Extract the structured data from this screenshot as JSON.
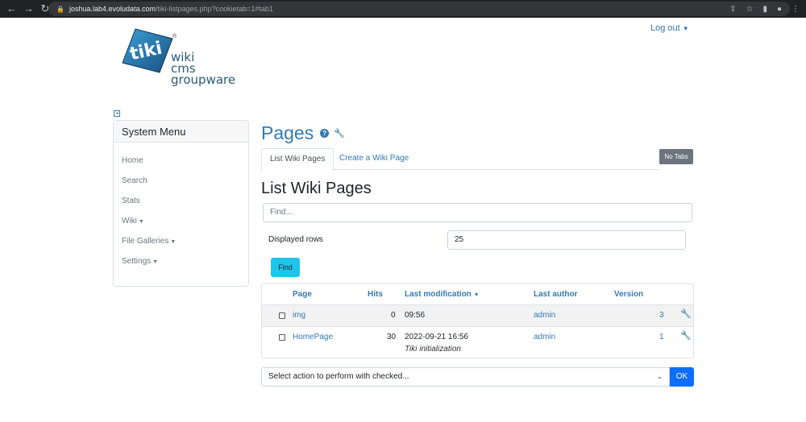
{
  "browser": {
    "url_host": "joshua.lab4.evoludata.com",
    "url_path": "/tiki-listpages.php?cookietab=1#tab1"
  },
  "header": {
    "logout_label": "Log out",
    "logo_text": "tiki",
    "logo_lines": [
      "wiki",
      "cms",
      "groupware"
    ]
  },
  "sidebar": {
    "title": "System Menu",
    "items": [
      {
        "label": "Home"
      },
      {
        "label": "Search"
      },
      {
        "label": "Stats"
      },
      {
        "label": "Wiki"
      },
      {
        "label": "File Galleries"
      },
      {
        "label": "Settings"
      }
    ]
  },
  "main": {
    "page_title": "Pages",
    "tabs": [
      {
        "label": "List Wiki Pages"
      },
      {
        "label": "Create a Wiki Page"
      }
    ],
    "no_tabs_label": "No Tabs",
    "section_title": "List Wiki Pages",
    "find_placeholder": "Find...",
    "displayed_rows_label": "Displayed rows",
    "displayed_rows_value": "25",
    "find_button": "Find",
    "table": {
      "headers": [
        "Page",
        "Hits",
        "Last modification",
        "Last author",
        "Version"
      ],
      "rows": [
        {
          "page": "img",
          "hits": "0",
          "modified": "09:56",
          "note": "",
          "author": "admin",
          "version": "3"
        },
        {
          "page": "HomePage",
          "hits": "30",
          "modified": "2022-09-21 16:56",
          "note": "Tiki initialization",
          "author": "admin",
          "version": "1"
        }
      ]
    },
    "action_select": "Select action to perform with checked...",
    "ok_button": "OK"
  },
  "colors": {
    "link": "#337ab7",
    "find_button": "#1ec5ea",
    "ok_button": "#0d6efd",
    "no_tabs": "#6c757d"
  }
}
